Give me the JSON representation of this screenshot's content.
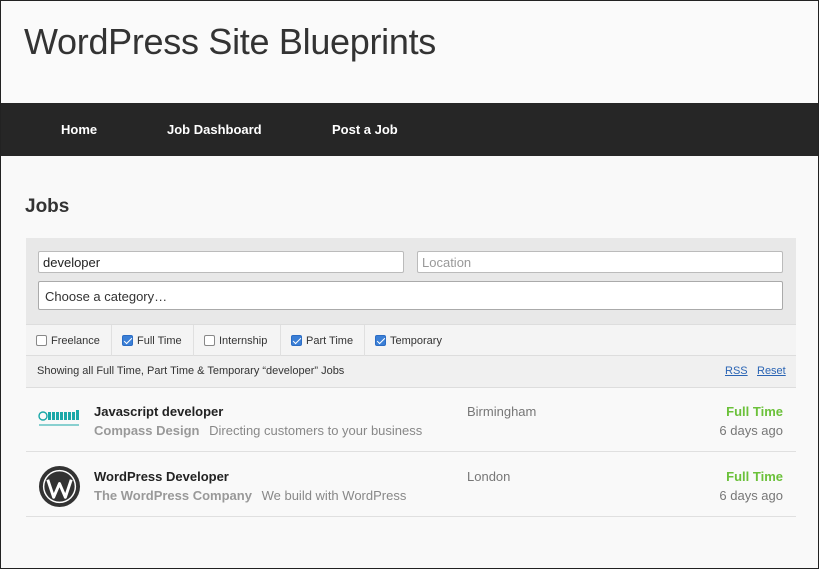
{
  "site": {
    "title": "WordPress Site Blueprints"
  },
  "nav": {
    "items": [
      {
        "label": "Home"
      },
      {
        "label": "Job Dashboard"
      },
      {
        "label": "Post a Job"
      }
    ]
  },
  "page": {
    "title": "Jobs"
  },
  "search": {
    "keywords_value": "developer",
    "location_placeholder": "Location",
    "category_label": "Choose a category…"
  },
  "job_types": [
    {
      "label": "Freelance",
      "checked": false
    },
    {
      "label": "Full Time",
      "checked": true
    },
    {
      "label": "Internship",
      "checked": false
    },
    {
      "label": "Part Time",
      "checked": true
    },
    {
      "label": "Temporary",
      "checked": true
    }
  ],
  "summary": {
    "text": "Showing all Full Time, Part Time & Temporary “developer” Jobs",
    "rss_label": "RSS",
    "reset_label": "Reset"
  },
  "jobs": [
    {
      "title": "Javascript developer",
      "company": "Compass Design",
      "tagline": "Directing customers to your business",
      "location": "Birmingham",
      "type": "Full Time",
      "date": "6 days ago",
      "logo": "compass-design-logo"
    },
    {
      "title": "WordPress Developer",
      "company": "The WordPress Company",
      "tagline": "We build with WordPress",
      "location": "London",
      "type": "Full Time",
      "date": "6 days ago",
      "logo": "wordpress-logo"
    }
  ],
  "colors": {
    "nav_bg": "#262626",
    "job_type": "#6bc13a",
    "link": "#2a64b4",
    "checkbox": "#3b7fd6"
  }
}
